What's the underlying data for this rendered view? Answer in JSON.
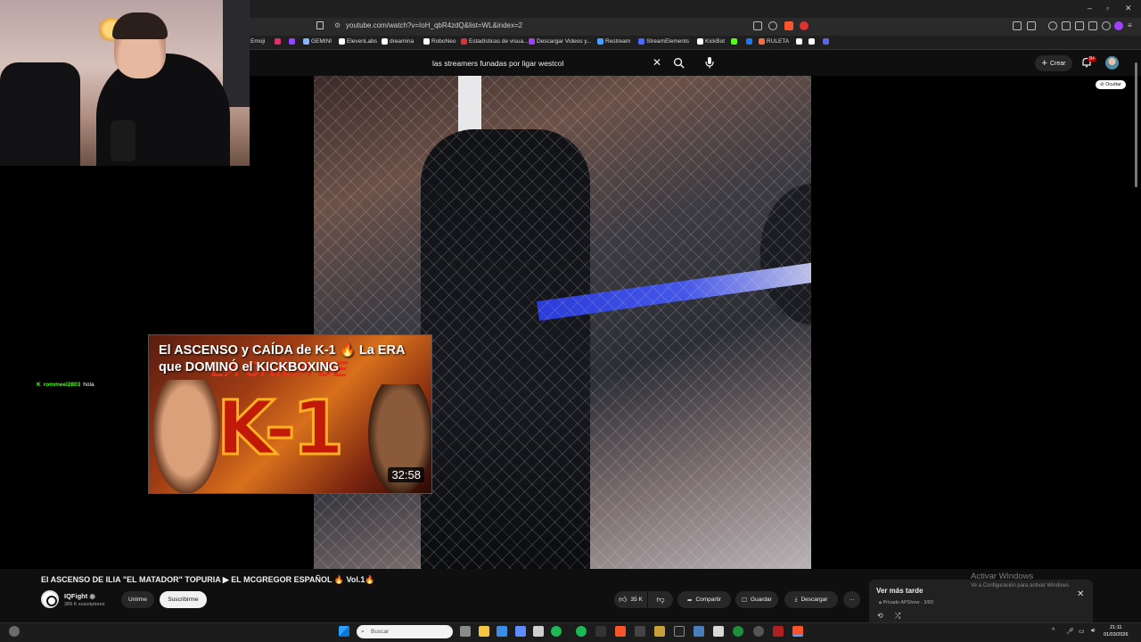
{
  "browser": {
    "url": "youtube.com/watch?v=IoH_qbR4zdQ&list=WL&index=2",
    "window_controls": [
      "–",
      "▫",
      "✕"
    ],
    "bookmarks": [
      {
        "label": "Emoji",
        "color": "#ffcc33"
      },
      {
        "label": "",
        "color": "#e1306c"
      },
      {
        "label": "",
        "color": "#9146ff"
      },
      {
        "label": "GEMINI",
        "color": "#8ab4f8"
      },
      {
        "label": "ElevenLabs",
        "color": "#ffffff"
      },
      {
        "label": "dreamina",
        "color": "#ffffff"
      },
      {
        "label": "RoboNeo",
        "color": "#ffffff"
      },
      {
        "label": "Estadísticas de visua...",
        "color": "#e03030"
      },
      {
        "label": "Descargar Videos y...",
        "color": "#a040ff"
      },
      {
        "label": "Restream",
        "color": "#4aa0ff"
      },
      {
        "label": "StreamElements",
        "color": "#4a6bff"
      },
      {
        "label": "KickBot",
        "color": "#ffffff"
      },
      {
        "label": "",
        "color": "#53fc18"
      },
      {
        "label": "",
        "color": "#1877f2"
      },
      {
        "label": "RULETA",
        "color": "#ff6a3a"
      },
      {
        "label": "",
        "color": "#ffffff"
      },
      {
        "label": "",
        "color": "#ffffff"
      },
      {
        "label": "",
        "color": "#5865f2"
      }
    ]
  },
  "youtube": {
    "search_value": "las streamers funadas por ligar westcol",
    "create_label": "Crear",
    "notif_badge": "9+",
    "hide_label": "Ocultar",
    "video_title": "El ASCENSO DE ILIA \"EL MATADOR\" TOPURIA ▶ EL MCGREGOR ESPAÑOL 🔥 Vol.1🔥",
    "channel_name": "IQFight",
    "channel_subs": "389 K suscriptores",
    "join_label": "Unirme",
    "subscribe_label": "Suscribirme",
    "like_count": "35 K",
    "share_label": "Compartir",
    "save_label": "Guardar",
    "download_label": "Descargar",
    "more_label": "···"
  },
  "thumbnail": {
    "title": "El ASCENSO y CAÍDA de K-1 🔥 La ERA que DOMINÓ el KICKBOXING",
    "big_text": "K-1",
    "bg_text": "LA CAÍDA DE",
    "duration": "32:58"
  },
  "chat": {
    "user": "rommeel2803",
    "message": "hola",
    "badge": "K"
  },
  "playlist": {
    "title": "Ver más tarde",
    "subtitle": "Privado APShow · 3/83"
  },
  "watermark": {
    "line1": "Activar Windows",
    "line2": "Ve a Configuración para activar Windows."
  },
  "taskbar": {
    "search_placeholder": "Buscar",
    "time": "21:11",
    "date": "01/03/2026"
  },
  "colors": {
    "bg": "#0f0f0f",
    "kick_green": "#53fc18",
    "yt_red": "#cc0000"
  }
}
